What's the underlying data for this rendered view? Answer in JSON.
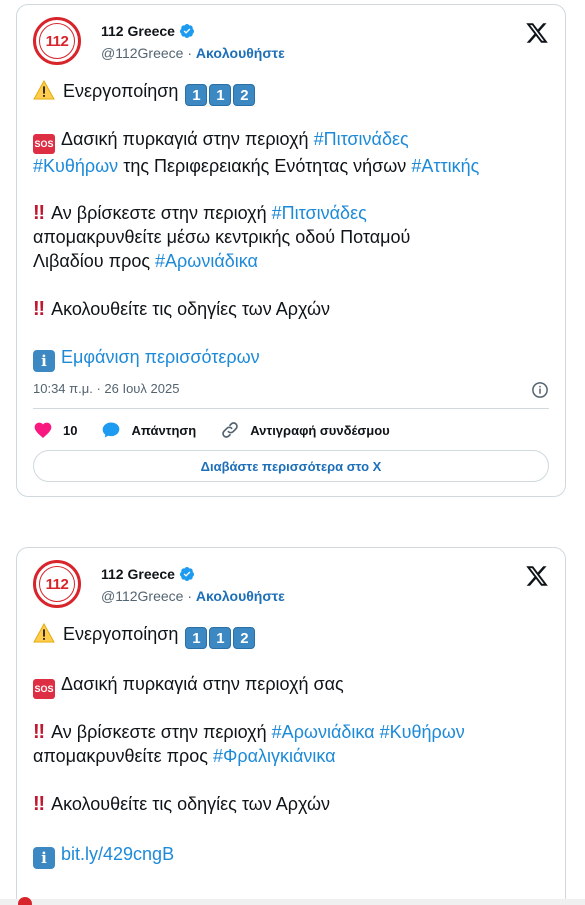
{
  "tweets": [
    {
      "author": {
        "name": "112 Greece",
        "handle": "@112Greece",
        "follow_label": "Ακολουθήστε",
        "avatar_text": "112"
      },
      "lines": {
        "l1": "Ενεργοποίηση",
        "l2_a": "Δασική πυρκαγιά στην περιοχή",
        "l2_h1": "#Πιτσινάδες",
        "l3_h1": "#Κυθήρων",
        "l3_b": "της Περιφερειακής Ενότητας νήσων",
        "l3_h2": "#Αττικής",
        "l4_a": "Αν βρίσκεστε στην περιοχή",
        "l4_h1": "#Πιτσινάδες",
        "l5": "απομακρυνθείτε μέσω κεντρικής οδού Ποταμού",
        "l6_a": "Λιβαδίου προς",
        "l6_h1": "#Αρωνιάδικα",
        "l7": "Ακολουθείτε τις οδηγίες των Αρχών",
        "l8_link": "Εμφάνιση περισσότερων"
      },
      "keycaps": [
        "1",
        "1",
        "2"
      ],
      "timestamp": "10:34 π.μ. · 26 Ιουλ 2025",
      "actions": {
        "likes": "10",
        "reply": "Απάντηση",
        "copy_link": "Αντιγραφή συνδέσμου"
      },
      "read_more": "Διαβάστε περισσότερα στο X"
    },
    {
      "author": {
        "name": "112 Greece",
        "handle": "@112Greece",
        "follow_label": "Ακολουθήστε",
        "avatar_text": "112"
      },
      "lines": {
        "l1": "Ενεργοποίηση",
        "l2_a": "Δασική πυρκαγιά στην περιοχή σας",
        "l4_a": "Αν βρίσκεστε στην περιοχή",
        "l4_h1": "#Αρωνιάδικα",
        "l4_h2": "#Κυθήρων",
        "l5_a": "απομακρυνθείτε προς",
        "l5_h1": "#Φραλιγκιάνικα",
        "l7": "Ακολουθείτε τις οδηγίες των Αρχών",
        "l8_link": "bit.ly/429cngB"
      },
      "keycaps": [
        "1",
        "1",
        "2"
      ]
    }
  ],
  "emoji": {
    "sos": "SOS",
    "bang": "‼",
    "info": "i"
  },
  "icons": [
    "verified-badge-icon",
    "x-logo-icon",
    "warning-icon",
    "sos-icon",
    "double-exclamation-icon",
    "info-icon",
    "heart-icon",
    "reply-bubble-icon",
    "link-icon",
    "info-circle-icon"
  ],
  "colors": {
    "hashtag": "#1d8ad8",
    "follow": "#1d6fb8",
    "heart": "#f91880",
    "brand_red": "#d8242b",
    "keycap": "#3b88c3"
  }
}
